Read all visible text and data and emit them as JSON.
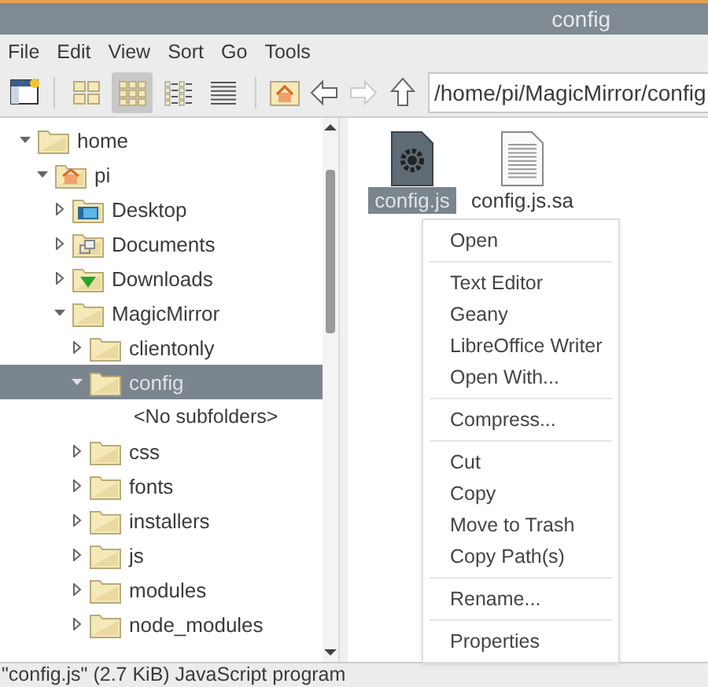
{
  "window": {
    "title": "config"
  },
  "menu_bar": [
    "File",
    "Edit",
    "View",
    "Sort",
    "Go",
    "Tools"
  ],
  "toolbar": {
    "views": [
      {
        "kind": "icons",
        "selected": false
      },
      {
        "kind": "thumbnails",
        "selected": true
      },
      {
        "kind": "compact",
        "selected": false
      },
      {
        "kind": "list",
        "selected": false
      }
    ],
    "path": "/home/pi/MagicMirror/config"
  },
  "tree": [
    {
      "label": "home",
      "kind": "plain",
      "expanded": true,
      "selected": false,
      "children": [
        {
          "label": "pi",
          "kind": "home",
          "expanded": true,
          "selected": false,
          "children": [
            {
              "label": "Desktop",
              "kind": "desktop",
              "expanded": false,
              "selected": false
            },
            {
              "label": "Documents",
              "kind": "documents",
              "expanded": false,
              "selected": false
            },
            {
              "label": "Downloads",
              "kind": "downloads",
              "expanded": false,
              "selected": false
            },
            {
              "label": "MagicMirror",
              "kind": "plain",
              "expanded": true,
              "selected": false,
              "children": [
                {
                  "label": "clientonly",
                  "kind": "plain",
                  "expanded": false,
                  "selected": false
                },
                {
                  "label": "config",
                  "kind": "plain",
                  "expanded": true,
                  "selected": true,
                  "empty_note": "<No subfolders>"
                },
                {
                  "label": "css",
                  "kind": "plain",
                  "expanded": false,
                  "selected": false
                },
                {
                  "label": "fonts",
                  "kind": "plain",
                  "expanded": false,
                  "selected": false
                },
                {
                  "label": "installers",
                  "kind": "plain",
                  "expanded": false,
                  "selected": false
                },
                {
                  "label": "js",
                  "kind": "plain",
                  "expanded": false,
                  "selected": false
                },
                {
                  "label": "modules",
                  "kind": "plain",
                  "expanded": false,
                  "selected": false
                },
                {
                  "label": "node_modules",
                  "kind": "plain",
                  "expanded": false,
                  "selected": false
                }
              ]
            }
          ]
        }
      ]
    }
  ],
  "files": [
    {
      "name": "config.js",
      "kind": "script",
      "selected": true
    },
    {
      "name": "config.js.sa",
      "kind": "text",
      "selected": false
    }
  ],
  "context_menu": [
    {
      "kind": "item",
      "label": "Open"
    },
    {
      "kind": "separator"
    },
    {
      "kind": "item",
      "label": "Text Editor"
    },
    {
      "kind": "item",
      "label": "Geany"
    },
    {
      "kind": "item",
      "label": "LibreOffice Writer"
    },
    {
      "kind": "item",
      "label": "Open With..."
    },
    {
      "kind": "separator"
    },
    {
      "kind": "item",
      "label": "Compress..."
    },
    {
      "kind": "separator"
    },
    {
      "kind": "item",
      "label": "Cut"
    },
    {
      "kind": "item",
      "label": "Copy"
    },
    {
      "kind": "item",
      "label": "Move to Trash"
    },
    {
      "kind": "item",
      "label": "Copy Path(s)"
    },
    {
      "kind": "separator"
    },
    {
      "kind": "item",
      "label": "Rename..."
    },
    {
      "kind": "separator"
    },
    {
      "kind": "item",
      "label": "Properties"
    }
  ],
  "status_bar": "\"config.js\" (2.7 KiB) JavaScript program"
}
